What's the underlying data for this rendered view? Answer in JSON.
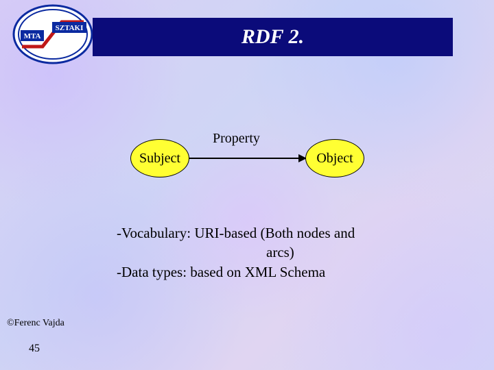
{
  "logo": {
    "left_label": "MTA",
    "right_label": "SZTAKI",
    "bg": "#ffffff",
    "blue": "#0b2aa0",
    "red": "#c01818"
  },
  "title": "RDF 2.",
  "diagram": {
    "subject": "Subject",
    "property": "Property",
    "object": "Object"
  },
  "body": {
    "line1a": "-Vocabulary: URI-based (Both nodes and",
    "line1b": "arcs)",
    "line2": "-Data types: based on XML Schema"
  },
  "footer": {
    "author": "©Ferenc Vajda",
    "page": "45"
  }
}
